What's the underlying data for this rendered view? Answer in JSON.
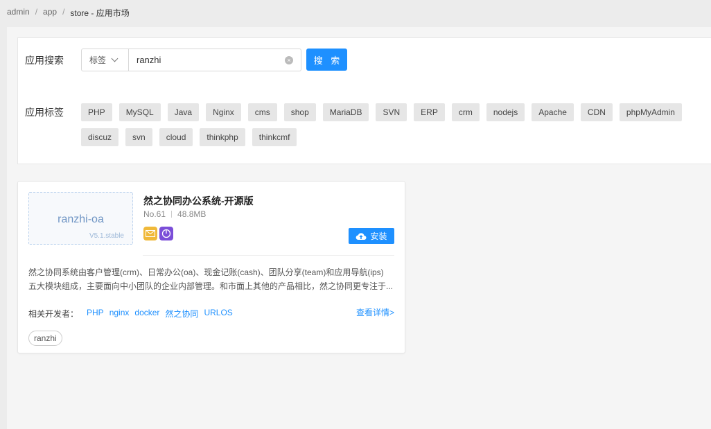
{
  "breadcrumb": {
    "items": [
      "admin",
      "app",
      "store"
    ],
    "separator": "/",
    "current": "store - 应用市场"
  },
  "search": {
    "label": "应用搜索",
    "select_value": "标签",
    "input_value": "ranzhi",
    "button_label": "搜 索"
  },
  "tags": {
    "label": "应用标签",
    "items": [
      "PHP",
      "MySQL",
      "Java",
      "Nginx",
      "cms",
      "shop",
      "MariaDB",
      "SVN",
      "ERP",
      "crm",
      "nodejs",
      "Apache",
      "CDN",
      "phpMyAdmin",
      "discuz",
      "svn",
      "cloud",
      "thinkphp",
      "thinkcmf"
    ]
  },
  "app": {
    "logo_name": "ranzhi-oa",
    "version": "V5.1.stable",
    "title": "然之协同办公系统-开源版",
    "number": "No.61",
    "size": "48.8MB",
    "install_label": "安装",
    "description_line1": "然之协同系统由客户管理(crm)、日常办公(oa)、现金记账(cash)、团队分享(team)和应用导航(ips)",
    "description_line2": "五大模块组成，主要面向中小团队的企业内部管理。和市面上其他的产品相比，然之协同更专注于...",
    "developers_label": "相关开发者：",
    "developers": [
      "PHP",
      "nginx",
      "docker",
      "然之协同",
      "URLOS"
    ],
    "details_link": "查看详情>",
    "tag": "ranzhi"
  },
  "colors": {
    "accent": "#1e90ff",
    "badge_mail": "#f0b93a",
    "badge_power": "#7b4ed8"
  }
}
